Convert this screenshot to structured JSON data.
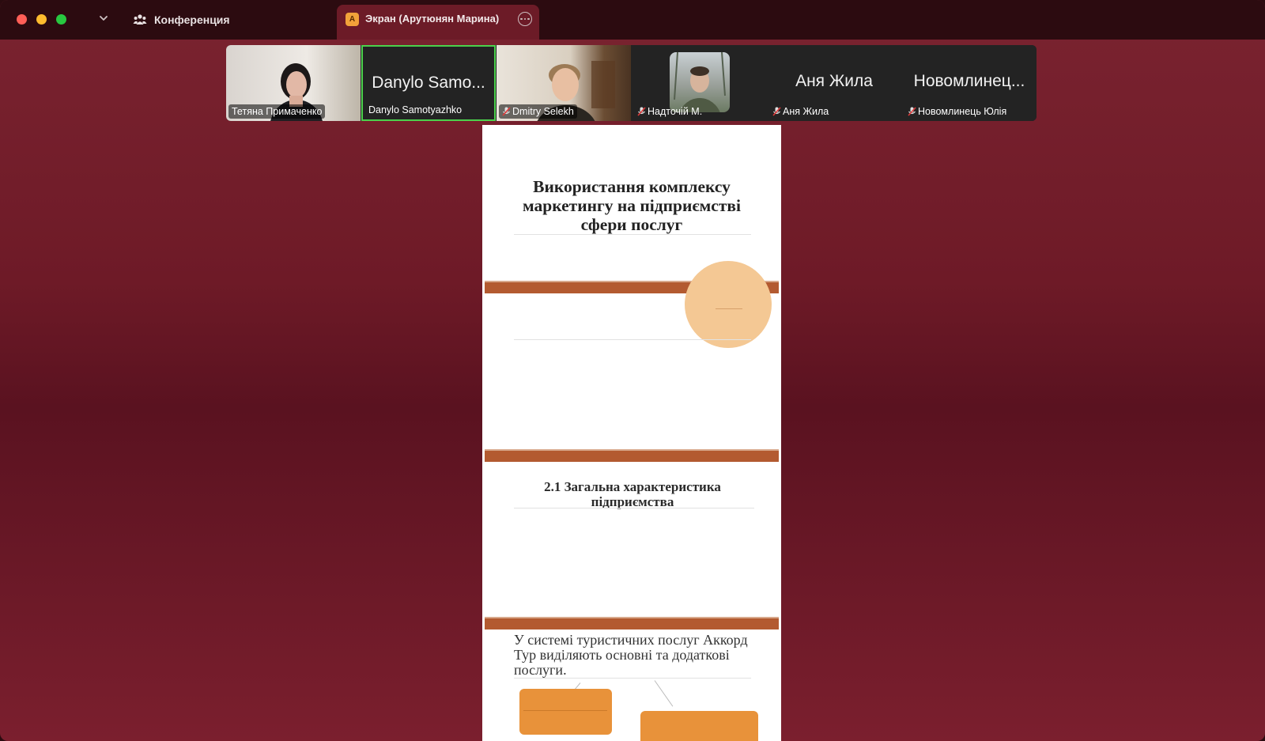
{
  "titlebar": {
    "conference_label": "Конференция",
    "screen_badge": "A",
    "screen_tab_label": "Экран (Арутюнян Марина)"
  },
  "participants": [
    {
      "name": "Тетяна Примаченко",
      "display": "",
      "muted": false
    },
    {
      "name": "Danylo Samotyazhko",
      "display": "Danylo Samo...",
      "muted": false
    },
    {
      "name": "Dmitry Selekh",
      "display": "",
      "muted": true
    },
    {
      "name": "Надточій М.",
      "display": "",
      "muted": true
    },
    {
      "name": "Аня Жила",
      "display": "Аня Жила",
      "muted": true
    },
    {
      "name": "Новомлинець Юлія",
      "display": "Новомлинец...",
      "muted": true
    }
  ],
  "slides": {
    "slide1_title": "Використання комплексу маркетингу на підприємстві сфери послуг",
    "slide3_title": "2.1 Загальна характеристика підприємства",
    "slide4_text": "У системі туристичних послуг Аккорд Тур виділяють основні та додаткові послуги."
  },
  "colors": {
    "titlebar_bg": "#2c0b10",
    "window_bg": "#6e1a27",
    "active_speaker_border": "#4cd04c",
    "slide_bar": "#b35a30",
    "slide_box": "#e8923a",
    "slide_circle": "#f4c894"
  }
}
